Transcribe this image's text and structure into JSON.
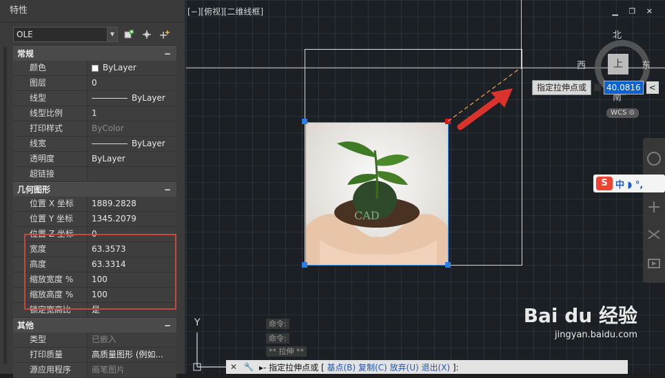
{
  "panel": {
    "title": "特性",
    "object_select": "OLE",
    "sections": [
      {
        "title": "常规",
        "rows": [
          {
            "k": "颜色",
            "v": "ByLayer",
            "swatch": true
          },
          {
            "k": "图层",
            "v": "0"
          },
          {
            "k": "线型",
            "v": "ByLayer",
            "line": true
          },
          {
            "k": "线型比例",
            "v": "1"
          },
          {
            "k": "打印样式",
            "v": "ByColor",
            "dim": true
          },
          {
            "k": "线宽",
            "v": "ByLayer",
            "line": true
          },
          {
            "k": "透明度",
            "v": "ByLayer"
          },
          {
            "k": "超链接",
            "v": ""
          }
        ]
      },
      {
        "title": "几何图形",
        "rows": [
          {
            "k": "位置 X 坐标",
            "v": "1889.2828"
          },
          {
            "k": "位置 Y 坐标",
            "v": "1345.2079"
          },
          {
            "k": "位置 Z 坐标",
            "v": "0"
          },
          {
            "k": "宽度",
            "v": "63.3573"
          },
          {
            "k": "高度",
            "v": "63.3314"
          },
          {
            "k": "缩放宽度 %",
            "v": "100"
          },
          {
            "k": "缩放高度 %",
            "v": "100"
          },
          {
            "k": "锁定宽高比",
            "v": "是"
          }
        ]
      },
      {
        "title": "其他",
        "rows": [
          {
            "k": "类型",
            "v": "已嵌入",
            "dim": true
          },
          {
            "k": "打印质量",
            "v": "高质量图形 (例如..."
          },
          {
            "k": "源应用程序",
            "v": "画笔图片",
            "dim": true
          }
        ]
      }
    ]
  },
  "viewport": {
    "label": "[−][俯视][二维线框]",
    "window_controls": "▁ ❐ ✕",
    "compass": {
      "north": "北",
      "south": "南",
      "east": "东",
      "west": "西",
      "top": "上"
    },
    "wcs": "WCS ⊙",
    "dynamic_input": {
      "prompt": "指定拉伸点或",
      "value": "40.0816",
      "lt": "<"
    },
    "ime": {
      "s": "S",
      "text": "中 ◗ °,"
    },
    "command_history": [
      "命令:",
      "命令:",
      "** 拉伸 **"
    ],
    "ucs_y": "Y",
    "command_line": {
      "prefix": "▸- 指定拉伸点或 [",
      "opt1": "基点(B)",
      "opt2": "复制(C)",
      "opt3": "放弃(U)",
      "opt4": "退出(X)",
      "suffix": "]:"
    },
    "ole_text": "CAD"
  },
  "watermark": {
    "brand": "Bai du 经验",
    "url": "jingyan.baidu.com"
  },
  "colors": {
    "accent": "#0a62d6",
    "grip": "#2a7de1",
    "highlight": "#c9473f",
    "arrow": "#d9332b"
  }
}
